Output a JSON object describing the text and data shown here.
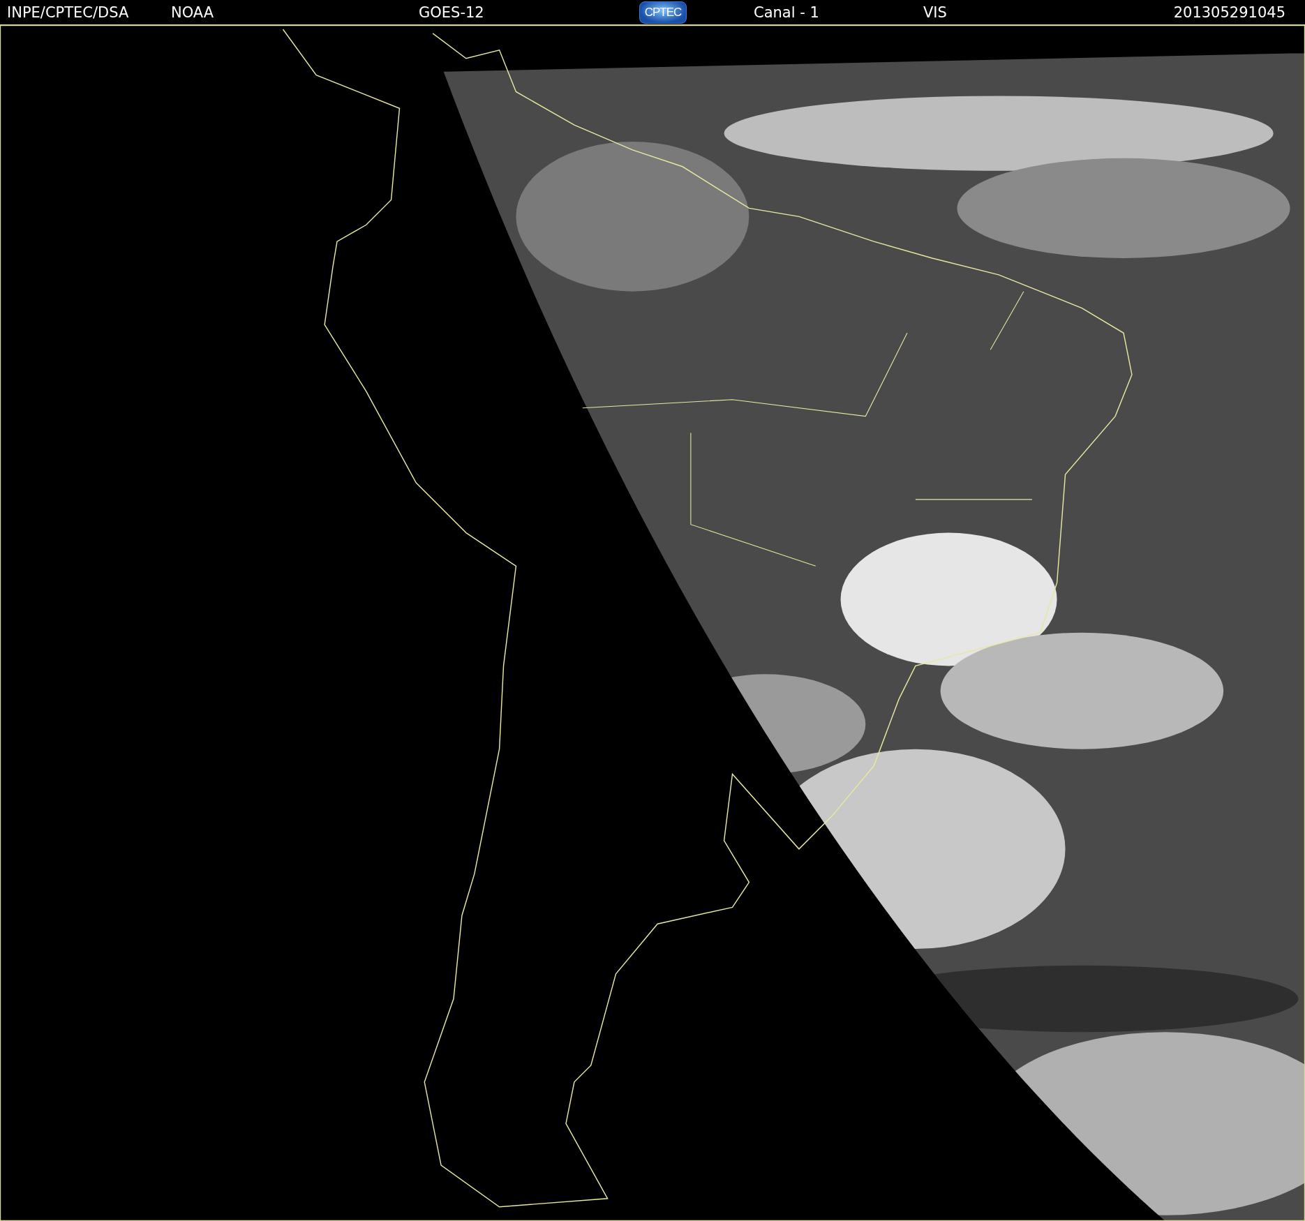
{
  "header": {
    "items": [
      {
        "kind": "text",
        "text": "INPE/CPTEC/DSA"
      },
      {
        "kind": "text",
        "text": "NOAA"
      },
      {
        "kind": "text",
        "text": "GOES-12"
      },
      {
        "kind": "logo",
        "text": "CPTEC"
      },
      {
        "kind": "text",
        "text": "Canal - 1"
      },
      {
        "kind": "text",
        "text": "VIS"
      },
      {
        "kind": "text",
        "text": "201305291045"
      }
    ]
  }
}
